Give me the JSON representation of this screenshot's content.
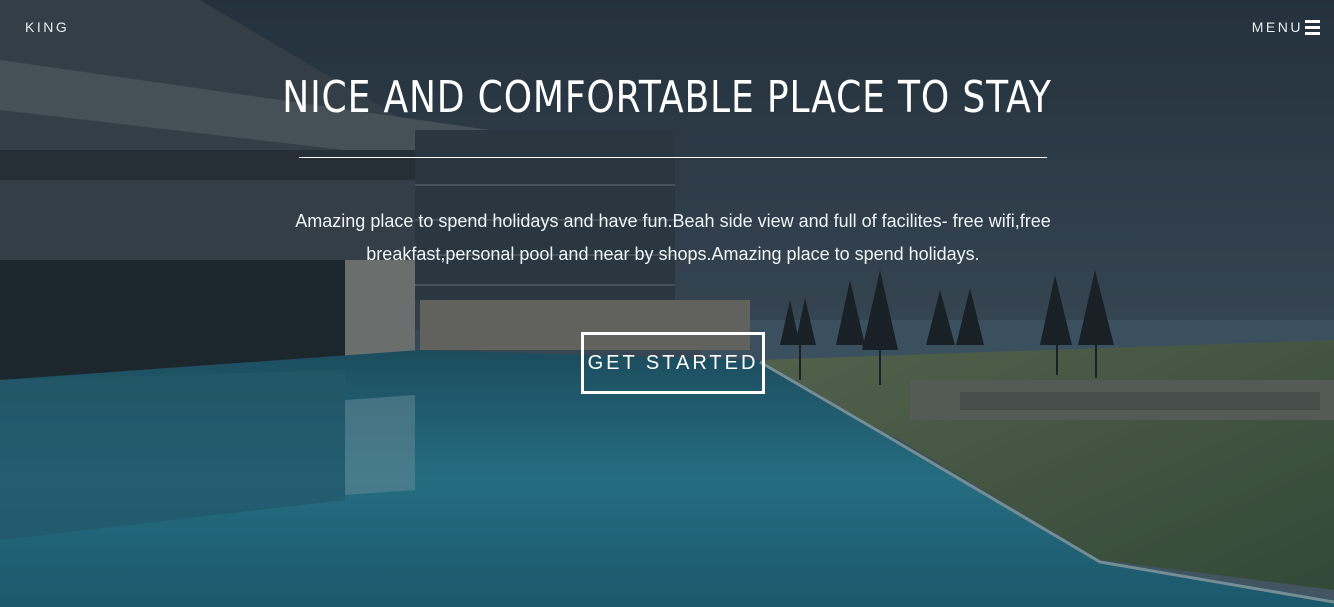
{
  "header": {
    "brand": "KING",
    "menu_label": "MENU"
  },
  "hero": {
    "title": "NICE AND COMFORTABLE PLACE TO STAY",
    "description": "Amazing place to spend holidays and have fun.Beah side view and full of facilites- free wifi,free breakfast,personal pool and near by shops.Amazing place to spend holidays.",
    "cta_label": "GET STARTED",
    "background": "resort-infinity-pool-photo"
  },
  "colors": {
    "sky": "#3b5160",
    "pool": "#2f8aa3",
    "pool_dark": "#1d5f74",
    "grass": "#5d7350",
    "building": "#3a4a52"
  },
  "icons": {
    "menu": "hamburger-icon"
  }
}
